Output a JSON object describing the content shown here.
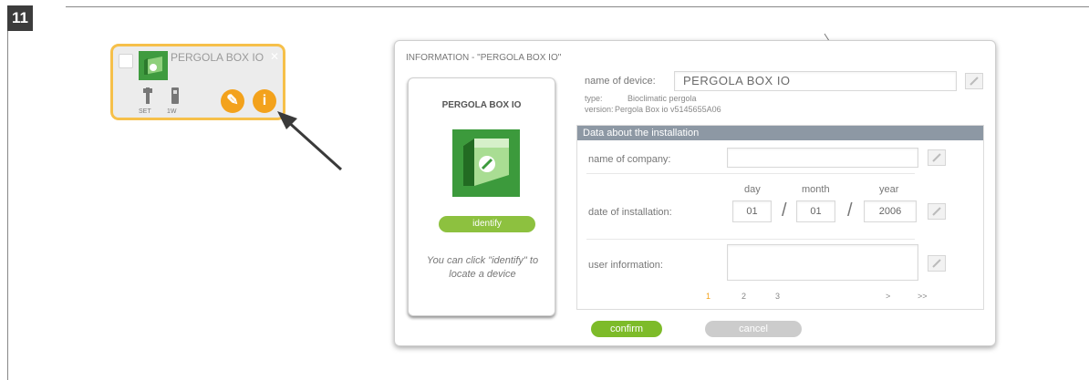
{
  "step": {
    "number": "11"
  },
  "device_tile": {
    "title": "PERGOLA BOX IO",
    "close_symbol": "✕",
    "tool_labels": [
      "SET",
      "1W"
    ],
    "edit_symbol": "✎",
    "info_symbol": "i",
    "icons": [
      "pergola-icon",
      "wrench-icon",
      "remote-icon",
      "edit-icon",
      "info-icon",
      "arrow-icon"
    ]
  },
  "dialog": {
    "title": "INFORMATION - \"PERGOLA BOX IO\"",
    "card": {
      "name": "PERGOLA BOX IO",
      "identify_label": "identify",
      "hint": "You can click \"identify\" to locate a device"
    },
    "device": {
      "name_label": "name of device:",
      "name_value": "PERGOLA BOX IO",
      "type_label": "type:",
      "type_value": "Bioclimatic pergola",
      "version_label": "version:",
      "version_value": "Pergola Box io v5145655A06"
    },
    "installation": {
      "header": "Data about the installation",
      "company_label": "name of company:",
      "company_value": "",
      "date_label": "date of installation:",
      "day_label": "day",
      "month_label": "month",
      "year_label": "year",
      "day_value": "01",
      "month_value": "01",
      "year_value": "2006",
      "separator": "/",
      "user_info_label": "user information:",
      "user_info_value": ""
    },
    "pagination": {
      "pages": [
        "1",
        "2",
        "3"
      ],
      "active_page": "1",
      "next": ">",
      "last": ">>"
    },
    "confirm_label": "confirm",
    "cancel_label": "cancel"
  },
  "colors": {
    "accent_orange": "#f3a21c",
    "tile_border": "#f6c04a",
    "green": "#7dbb29",
    "section_header": "#8d98a4"
  }
}
